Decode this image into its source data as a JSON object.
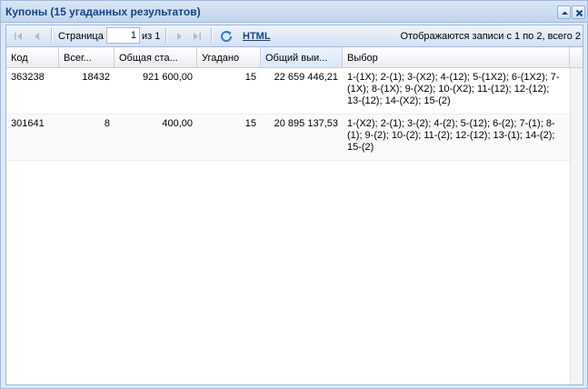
{
  "window": {
    "title": "Купоны (15 угаданных результатов)"
  },
  "toolbar": {
    "page_label": "Страница",
    "page_value": "1",
    "of_label": "из 1",
    "html_link": "HTML",
    "display_info": "Отображаются записи с 1 по 2, всего 2"
  },
  "grid": {
    "columns": [
      {
        "label": "Код"
      },
      {
        "label": "Всег..."
      },
      {
        "label": "Общая ста..."
      },
      {
        "label": "Угадано"
      },
      {
        "label": "Общий выи..."
      },
      {
        "label": "Выбор"
      }
    ],
    "rows": [
      {
        "code": "363238",
        "total": "18432",
        "stake": "921 600,00",
        "guessed": "15",
        "payout": "22 659 446,21",
        "choice": "1-(1X); 2-(1); 3-(X2); 4-(12); 5-(1X2); 6-(1X2); 7-(1X); 8-(1X); 9-(X2); 10-(X2); 11-(12); 12-(12); 13-(12); 14-(X2); 15-(2)"
      },
      {
        "code": "301641",
        "total": "8",
        "stake": "400,00",
        "guessed": "15",
        "payout": "20 895 137,53",
        "choice": "1-(X2); 2-(1); 3-(2); 4-(2); 5-(12); 6-(2); 7-(1); 8-(1); 9-(2); 10-(2); 11-(2); 12-(12); 13-(1); 14-(2); 15-(2)"
      }
    ]
  }
}
